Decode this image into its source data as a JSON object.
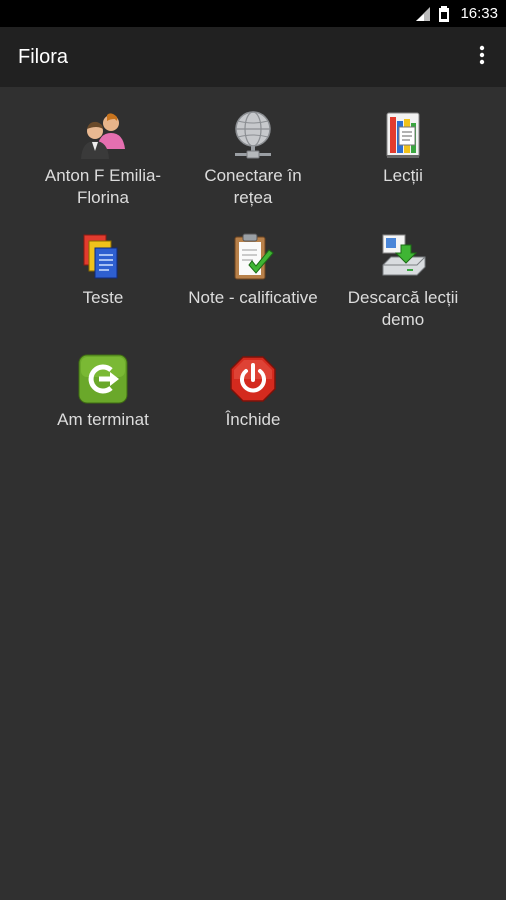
{
  "status_bar": {
    "time": "16:33"
  },
  "app_bar": {
    "title": "Filora"
  },
  "tiles": [
    {
      "label": "Anton F Emilia-\nFlorina",
      "icon": "users-icon"
    },
    {
      "label": "Conectare în\nrețea",
      "icon": "network-globe-icon"
    },
    {
      "label": "Lecții",
      "icon": "books-icon"
    },
    {
      "label": "Teste",
      "icon": "documents-icon"
    },
    {
      "label": "Note - calificative",
      "icon": "clipboard-check-icon"
    },
    {
      "label": "Descarcă lecții\ndemo",
      "icon": "download-drive-icon"
    },
    {
      "label": "Am terminat",
      "icon": "exit-arrow-icon"
    },
    {
      "label": "Închide",
      "icon": "power-icon"
    }
  ],
  "colors": {
    "background": "#303030",
    "action_bar": "#212121",
    "status_bar": "#000000",
    "exit_green": "#6aa82a",
    "close_red": "#d42a1e"
  }
}
